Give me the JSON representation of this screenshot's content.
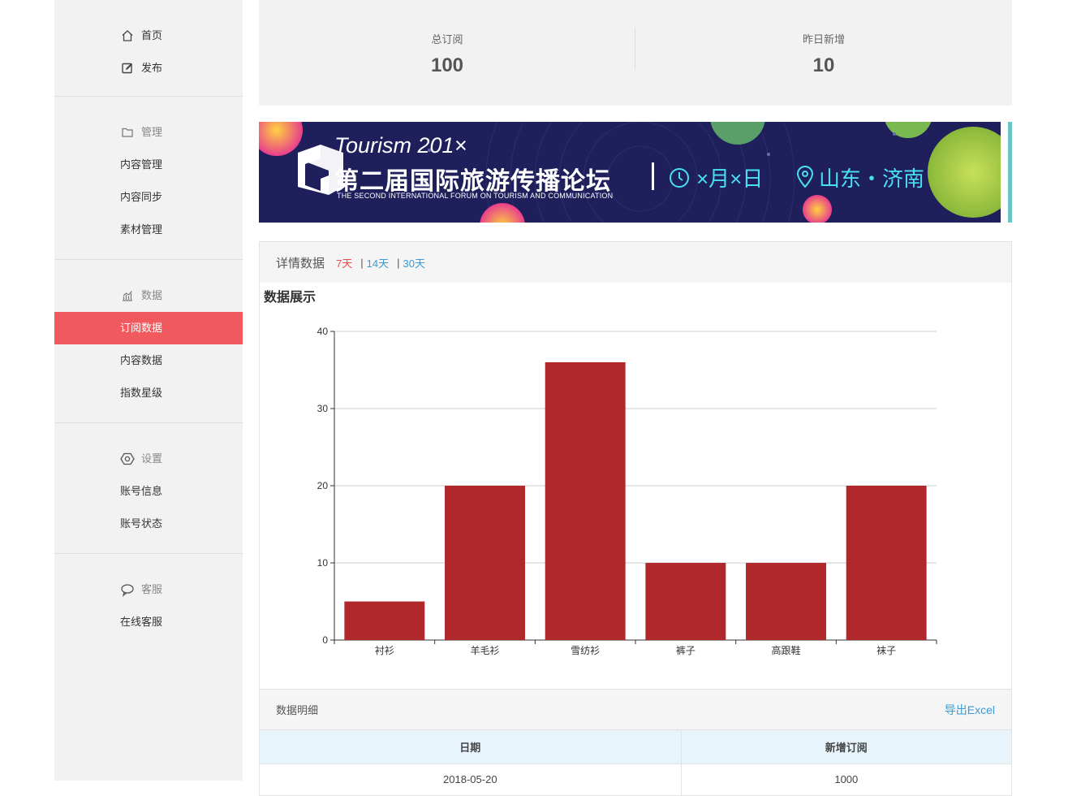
{
  "sidebar": {
    "home": "首页",
    "publish": "发布",
    "manage": {
      "title": "管理",
      "items": [
        "内容管理",
        "内容同步",
        "素材管理"
      ]
    },
    "data": {
      "title": "数据",
      "items": [
        "订阅数据",
        "内容数据",
        "指数星级"
      ],
      "active": "订阅数据"
    },
    "settings": {
      "title": "设置",
      "items": [
        "账号信息",
        "账号状态"
      ]
    },
    "service": {
      "title": "客服",
      "items": [
        "在线客服"
      ]
    }
  },
  "stats": [
    {
      "label": "总订阅",
      "value": "100"
    },
    {
      "label": "昨日新增",
      "value": "10"
    }
  ],
  "banner": {
    "line1": "Tourism 201×",
    "line2": "第二届国际旅游传播论坛",
    "line3": "THE SECOND INTERNATIONAL FORUM ON TOURISM AND COMMUNICATION",
    "date": "×月×日",
    "place": "山东・济南"
  },
  "detail": {
    "title": "详情数据",
    "ranges": [
      "7天",
      "14天",
      "30天"
    ],
    "active_range": "7天"
  },
  "chart_title": "数据展示",
  "chart_data": {
    "type": "bar",
    "categories": [
      "衬衫",
      "羊毛衫",
      "雪纺衫",
      "裤子",
      "高跟鞋",
      "袜子"
    ],
    "values": [
      5,
      20,
      36,
      10,
      10,
      20
    ],
    "yticks": [
      "0",
      "10",
      "20",
      "30",
      "40"
    ],
    "ylim": [
      0,
      40
    ],
    "grid": true,
    "color": "#b0282c"
  },
  "table": {
    "title": "数据明细",
    "export": "导出Excel",
    "headers": [
      "日期",
      "新增订阅"
    ],
    "rows": [
      [
        "2018-05-20",
        "1000"
      ]
    ]
  }
}
